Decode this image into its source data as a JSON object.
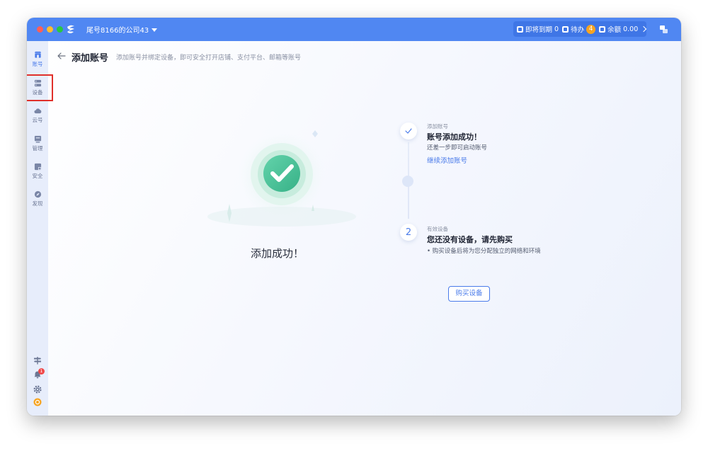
{
  "titlebar": {
    "company_name": "尾号8166的公司43",
    "expiring_label": "即将到期",
    "expiring_count": "0",
    "todo_label": "待办",
    "todo_count": "4",
    "balance_label": "余额",
    "balance_value": "0.00"
  },
  "sidebar": {
    "items": [
      {
        "label": "账号",
        "icon": "account-icon"
      },
      {
        "label": "设备",
        "icon": "device-icon"
      },
      {
        "label": "云号",
        "icon": "cloud-icon"
      },
      {
        "label": "管理",
        "icon": "manage-icon"
      },
      {
        "label": "安全",
        "icon": "security-icon"
      },
      {
        "label": "发现",
        "icon": "discover-icon"
      }
    ],
    "bell_badge": "1"
  },
  "page": {
    "title": "添加账号",
    "subtitle": "添加账号并绑定设备，即可安全打开店铺、支付平台、邮箱等账号",
    "success_message": "添加成功！"
  },
  "steps": [
    {
      "tag": "添加账号",
      "title": "账号添加成功！",
      "desc": "还差一步即可启动账号",
      "link": "继续添加账号"
    },
    {
      "number": "2",
      "tag": "有效设备",
      "title": "您还没有设备，请先购买",
      "desc": "购买设备后将为您分配独立的网络和环境",
      "button": "购买设备"
    }
  ],
  "colors": {
    "titlebar": "#5087f2",
    "accent": "#4a7bea",
    "success": "#4cc29a",
    "highlight": "#e0302b"
  }
}
